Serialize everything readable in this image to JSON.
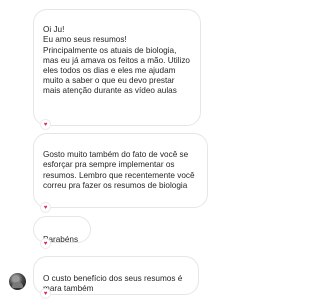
{
  "messages": [
    {
      "text": "Oi Ju!\nEu amo seus resumos!\nPrincipalmente os atuais de biologia, mas eu já amava os feitos a mão. Utilizo eles todos os dias e eles me ajudam muito a saber o que eu devo prestar mais atenção durante as vídeo aulas",
      "reaction": "heart-icon"
    },
    {
      "text": "Gosto muito também do fato de você se esforçar pra sempre implementar os resumos. Lembro que recentemente você correu pra fazer os resumos de biologia",
      "reaction": "heart-icon"
    },
    {
      "text": "Parabéns",
      "reaction": "heart-icon"
    },
    {
      "text": "O custo benefício dos seus resumos é mara também",
      "reaction": "heart-icon"
    }
  ],
  "icons": {
    "heart": "♥"
  },
  "colors": {
    "bubble_border": "#e6e6e6",
    "text": "#262626",
    "heart": "#e0245e"
  }
}
